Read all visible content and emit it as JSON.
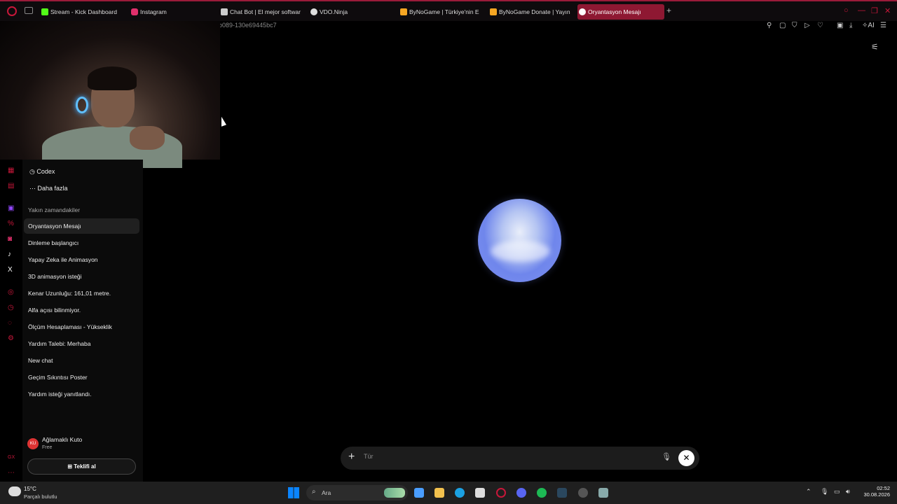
{
  "browser": {
    "tabs": [
      {
        "label": "Stream - Kick Dashboard",
        "icon": "kick-icon",
        "color": "#53fc18"
      },
      {
        "label": "Instagram",
        "icon": "instagram-icon",
        "color": "#e1306c"
      },
      {
        "label": "Chat Bot | El mejor softwar",
        "icon": "chatbot-icon",
        "color": "#cccccc"
      },
      {
        "label": "VDO.Ninja",
        "icon": "vdoninja-icon",
        "color": "#dddddd"
      },
      {
        "label": "ByNoGame | Türkiye'nin E",
        "icon": "bynogame-icon",
        "color": "#f5a623"
      },
      {
        "label": "ByNoGame Donate | Yayın",
        "icon": "bynogame-icon",
        "color": "#f5a623"
      },
      {
        "label": "Oryantasyon Mesajı",
        "icon": "chatgpt-icon",
        "color": "#ffffff",
        "active": true
      }
    ],
    "url_fragment": "o089-130e69445bc7",
    "toolbar_ai_label": "AI"
  },
  "sidebar": {
    "nav": [
      {
        "label": "Codex",
        "icon": "codex-icon"
      },
      {
        "label": "Daha fazla",
        "icon": "more-dots-icon"
      }
    ],
    "section_title": "Yakın zamandakiler",
    "history": [
      {
        "label": "Oryantasyon Mesajı",
        "active": true
      },
      {
        "label": "Dinleme başlangıcı"
      },
      {
        "label": "Yapay Zeka ile Animasyon"
      },
      {
        "label": "3D animasyon isteği"
      },
      {
        "label": "Kenar Uzunluğu: 161,01 metre."
      },
      {
        "label": "Alfa açısı bilinmiyor."
      },
      {
        "label": "Ölçüm Hesaplaması - Yükseklik"
      },
      {
        "label": "Yardım Talebi: Merhaba"
      },
      {
        "label": "New chat"
      },
      {
        "label": "Geçim Sıkıntısı Poster"
      },
      {
        "label": "Yardım isteği yanıtlandı."
      }
    ],
    "user": {
      "initials": "KU",
      "name": "Ağlamaklı Kuto",
      "plan": "Free"
    },
    "offer_button": "Teklifi al"
  },
  "composer": {
    "placeholder": "Tür"
  },
  "taskbar": {
    "weather_temp": "15°C",
    "weather_desc": "Parçalı bulutlu",
    "search_label": "Ara",
    "time": "02:52",
    "date": "30.08.2026"
  },
  "colors": {
    "accent": "#c8173a",
    "active_tab": "#8e1832"
  }
}
